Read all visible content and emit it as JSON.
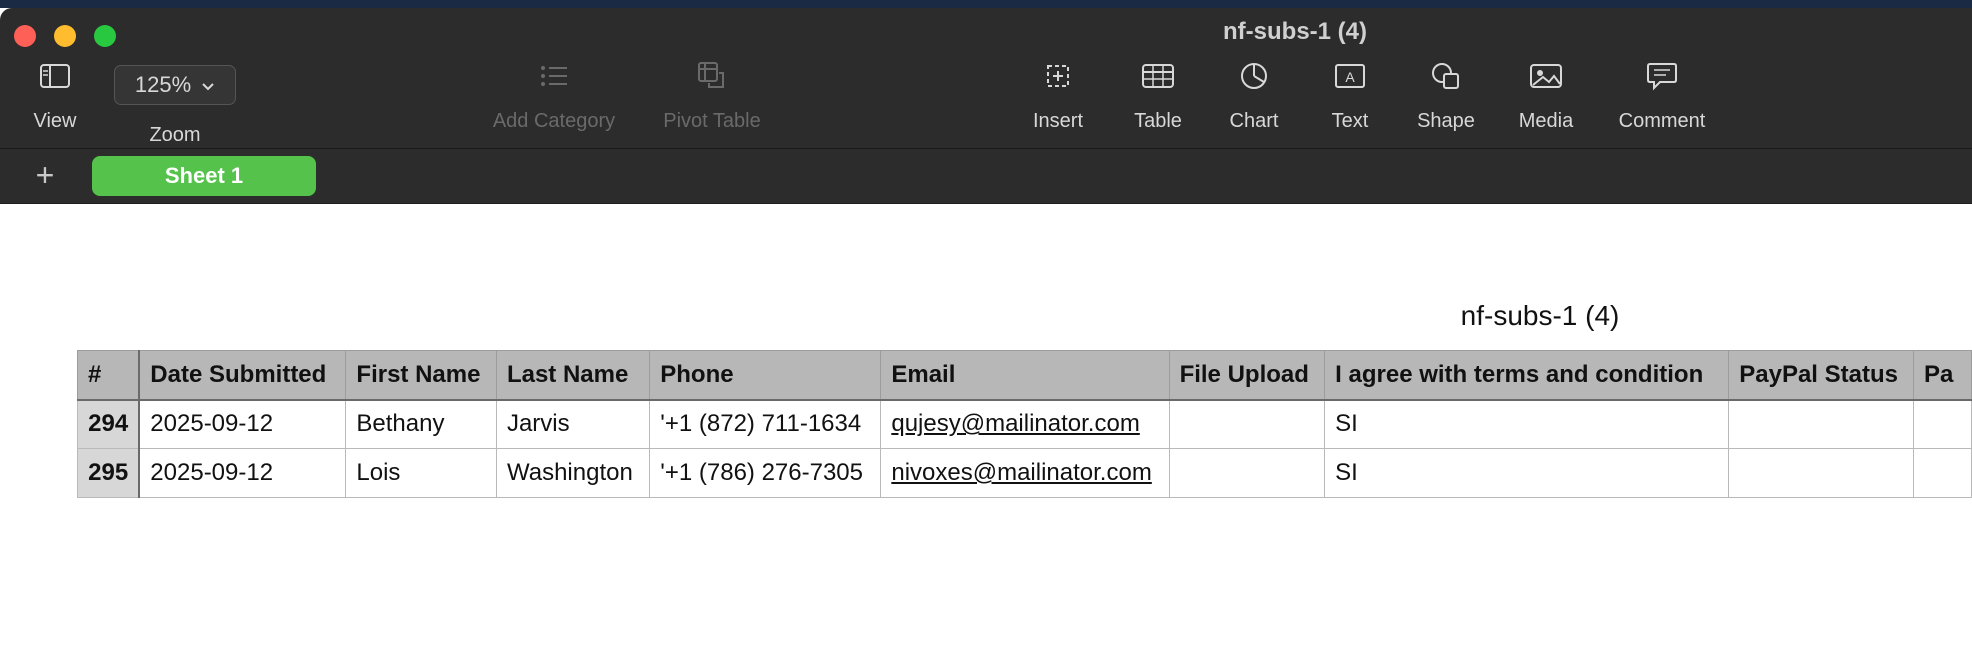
{
  "window": {
    "title": "nf-subs-1 (4)"
  },
  "toolbar": {
    "view_label": "View",
    "zoom_value": "125%",
    "zoom_label": "Zoom",
    "add_category_label": "Add Category",
    "pivot_table_label": "Pivot Table",
    "insert_label": "Insert",
    "table_label": "Table",
    "chart_label": "Chart",
    "text_label": "Text",
    "shape_label": "Shape",
    "media_label": "Media",
    "comment_label": "Comment"
  },
  "sheets": {
    "add_label": "+",
    "tabs": [
      {
        "label": "Sheet 1"
      }
    ]
  },
  "table": {
    "title": "nf-subs-1 (4)",
    "headers": [
      "#",
      "Date Submitted",
      "First Name",
      "Last Name",
      "Phone",
      "Email",
      "File Upload",
      "I agree with terms and condition",
      "PayPal Status",
      "Pa"
    ],
    "rows": [
      [
        "294",
        "2025-09-12",
        "Bethany",
        "Jarvis",
        "'+1 (872) 711-1634",
        "qujesy@mailinator.com",
        "",
        "SI",
        "",
        ""
      ],
      [
        "295",
        "2025-09-12",
        "Lois",
        "Washington",
        "'+1 (786) 276-7305",
        "nivoxes@mailinator.com",
        "",
        "SI",
        "",
        ""
      ]
    ]
  },
  "colors": {
    "toolbar_bg": "#2c2c2c",
    "sheet_tab": "#54c24b",
    "header_bg": "#b7b7b7",
    "rownum_bg": "#d7d7d7"
  }
}
